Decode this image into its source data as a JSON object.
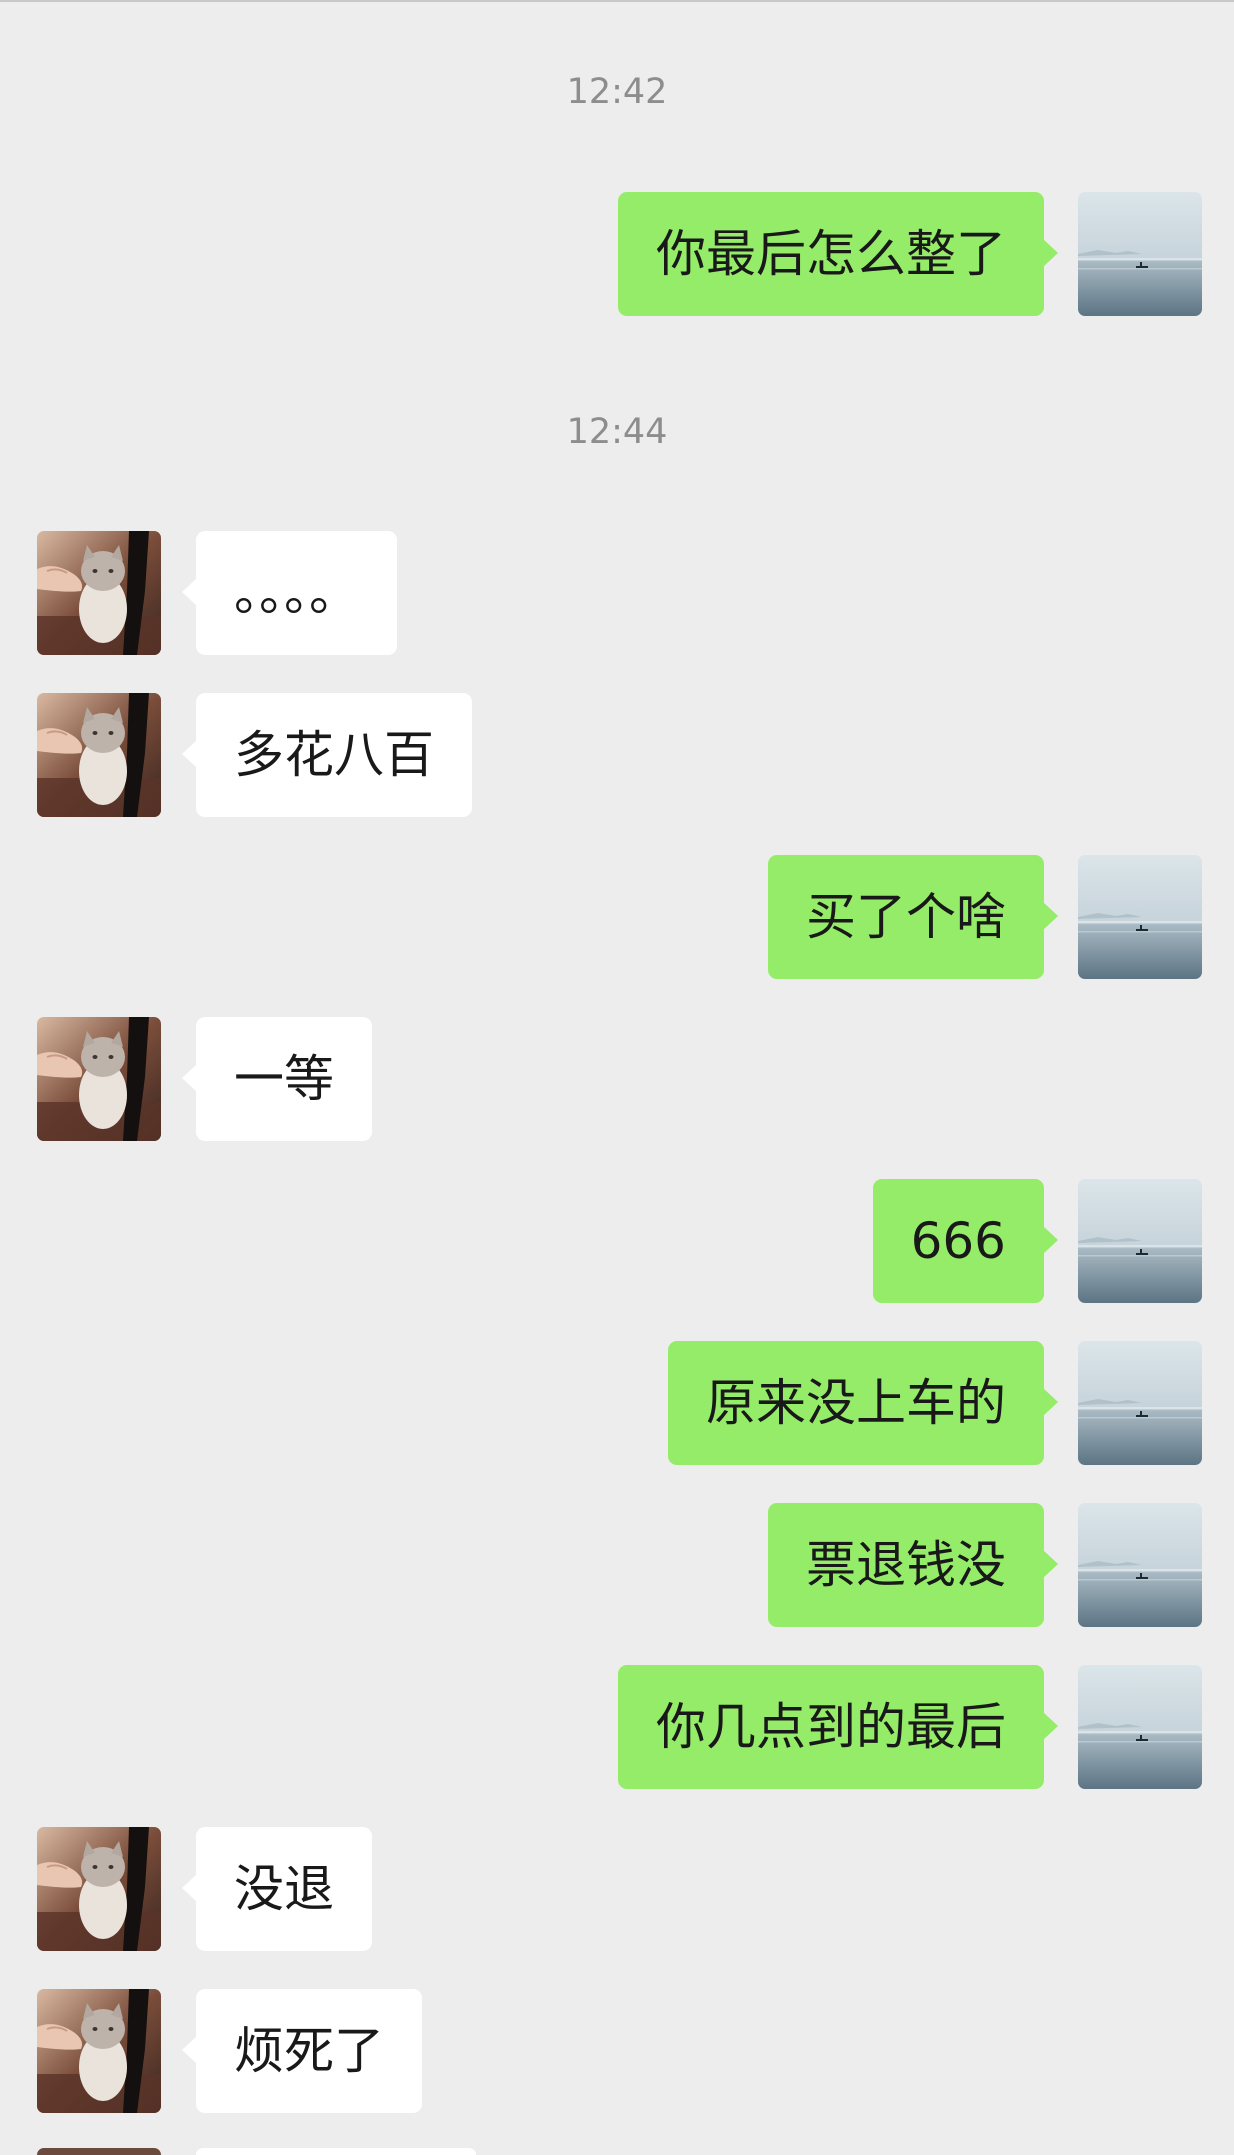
{
  "chat": {
    "timestamps": [
      "12:42",
      "12:44"
    ],
    "messages": [
      {
        "side": "out",
        "text": "你最后怎么整了"
      },
      {
        "side": "in",
        "text": "。。。。"
      },
      {
        "side": "in",
        "text": "多花八百"
      },
      {
        "side": "out",
        "text": "买了个啥"
      },
      {
        "side": "in",
        "text": "一等"
      },
      {
        "side": "out",
        "text": "666"
      },
      {
        "side": "out",
        "text": "原来没上车的"
      },
      {
        "side": "out",
        "text": "票退钱没"
      },
      {
        "side": "out",
        "text": "你几点到的最后"
      },
      {
        "side": "in",
        "text": "没退"
      },
      {
        "side": "in",
        "text": "烦死了"
      }
    ]
  },
  "avatars": {
    "self": "misty-lake-photo",
    "contact": "cat-photo"
  },
  "colors": {
    "background": "#ededed",
    "incoming_bubble": "#ffffff",
    "outgoing_bubble": "#95ec69",
    "timestamp_text": "#8d8d8d"
  }
}
